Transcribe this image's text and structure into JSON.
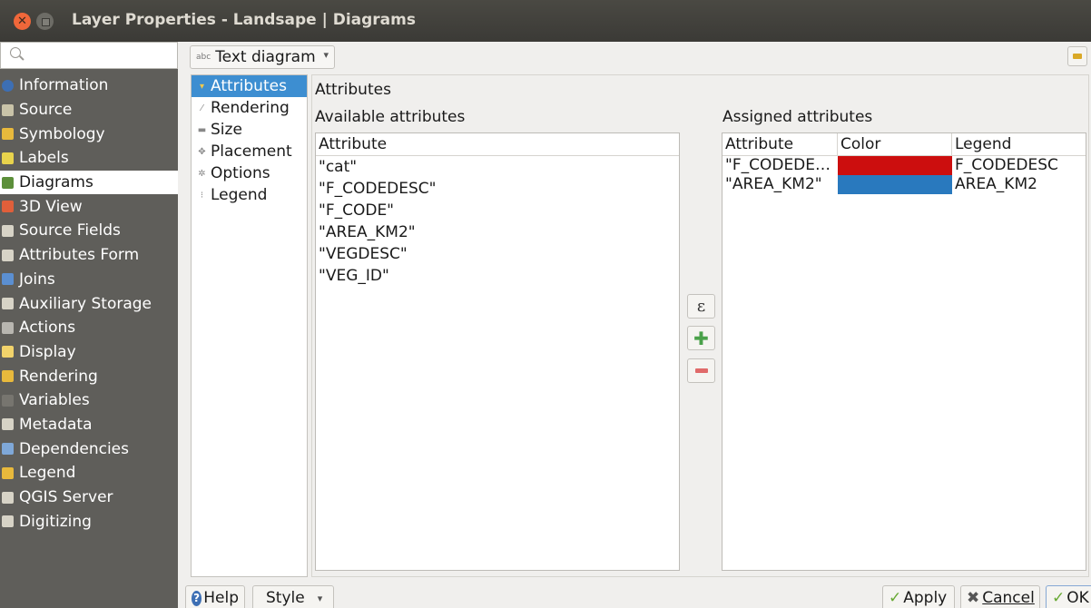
{
  "window": {
    "title": "Layer Properties - Landsape | Diagrams",
    "close_glyph": "✕"
  },
  "sidebar": {
    "items": [
      {
        "label": "Information",
        "icon": "info-icon",
        "color": "#3d6fb4"
      },
      {
        "label": "Source",
        "icon": "source-icon",
        "color": "#c9c3a8"
      },
      {
        "label": "Symbology",
        "icon": "symbology-icon",
        "color": "#e8b93c"
      },
      {
        "label": "Labels",
        "icon": "labels-icon",
        "color": "#e8d34c"
      },
      {
        "label": "Diagrams",
        "icon": "diagrams-icon",
        "color": "#5c8f3a"
      },
      {
        "label": "3D View",
        "icon": "3d-view-icon",
        "color": "#e05f3a"
      },
      {
        "label": "Source Fields",
        "icon": "source-fields-icon",
        "color": "#d7d3c6"
      },
      {
        "label": "Attributes Form",
        "icon": "attributes-form-icon",
        "color": "#d7d3c6"
      },
      {
        "label": "Joins",
        "icon": "joins-icon",
        "color": "#5b8fd1"
      },
      {
        "label": "Auxiliary Storage",
        "icon": "auxiliary-storage-icon",
        "color": "#d7d3c6"
      },
      {
        "label": "Actions",
        "icon": "actions-icon",
        "color": "#b8b6b0"
      },
      {
        "label": "Display",
        "icon": "display-icon",
        "color": "#f2d36b"
      },
      {
        "label": "Rendering",
        "icon": "rendering-icon",
        "color": "#e8b93c"
      },
      {
        "label": "Variables",
        "icon": "variables-icon",
        "color": "#77756f"
      },
      {
        "label": "Metadata",
        "icon": "metadata-icon",
        "color": "#d7d3c6"
      },
      {
        "label": "Dependencies",
        "icon": "dependencies-icon",
        "color": "#7fa8d8"
      },
      {
        "label": "Legend",
        "icon": "legend-icon",
        "color": "#e8b93c"
      },
      {
        "label": "QGIS Server",
        "icon": "qgis-server-icon",
        "color": "#d7d3c6"
      },
      {
        "label": "Digitizing",
        "icon": "digitizing-icon",
        "color": "#d7d3c6"
      }
    ],
    "active_index": 4
  },
  "toolbar": {
    "diagram_type": "Text diagram",
    "diagram_type_icon": "abc"
  },
  "subnav": {
    "items": [
      {
        "label": "Attributes",
        "icon": "▾"
      },
      {
        "label": "Rendering",
        "icon": "⁄"
      },
      {
        "label": "Size",
        "icon": "▬"
      },
      {
        "label": "Placement",
        "icon": "✥"
      },
      {
        "label": "Options",
        "icon": "✲"
      },
      {
        "label": "Legend",
        "icon": "⁝"
      }
    ],
    "active_index": 0
  },
  "main": {
    "section_title": "Attributes",
    "available": {
      "title": "Available attributes",
      "header": "Attribute",
      "rows": [
        "\"cat\"",
        "\"F_CODEDESC\"",
        "\"F_CODE\"",
        "\"AREA_KM2\"",
        "\"VEGDESC\"",
        "\"VEG_ID\""
      ]
    },
    "assigned": {
      "title": "Assigned attributes",
      "headers": [
        "Attribute",
        "Color",
        "Legend"
      ],
      "rows": [
        {
          "attribute": "\"F_CODEDE…",
          "color": "#cc0e0e",
          "legend": "F_CODEDESC"
        },
        {
          "attribute": "\"AREA_KM2\"",
          "color": "#2979be",
          "legend": "AREA_KM2"
        }
      ]
    },
    "buttons": {
      "expression": "ε",
      "add": "✚"
    }
  },
  "footer": {
    "help": "Help",
    "style": "Style",
    "style_arrow": "▾",
    "apply": "Apply",
    "cancel": "Cancel",
    "ok": "OK"
  }
}
